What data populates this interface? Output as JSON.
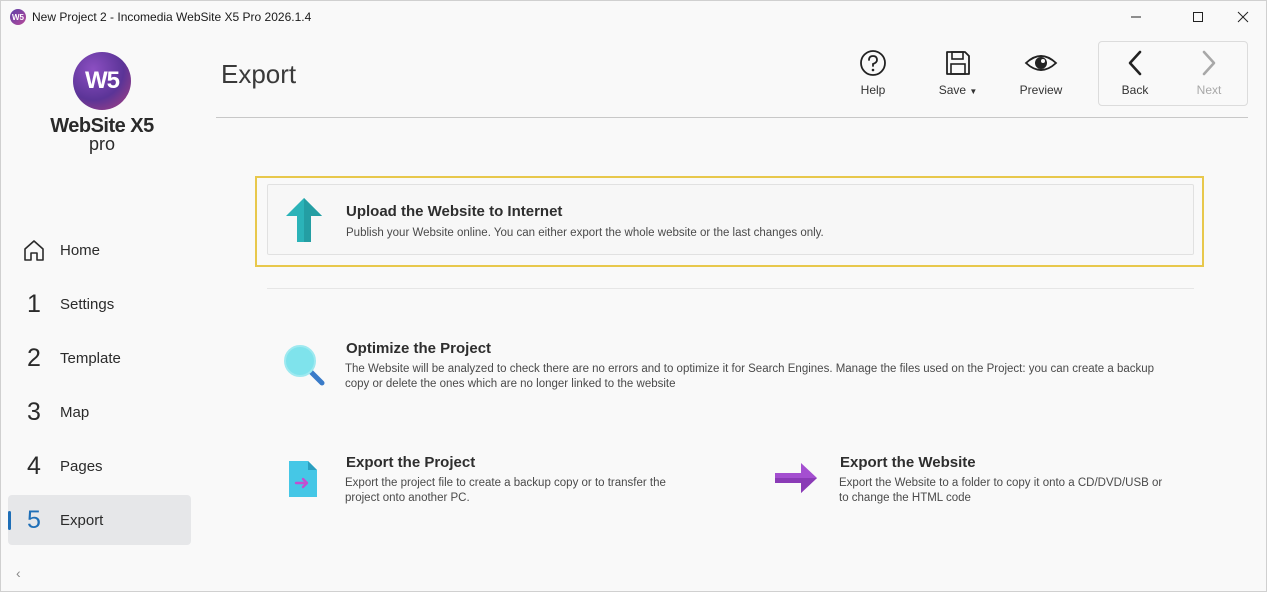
{
  "window": {
    "title": "New Project 2 - Incomedia WebSite X5 Pro 2026.1.4",
    "app_icon_text": "W5"
  },
  "logo": {
    "mark": "W5",
    "name": "WebSite X5",
    "sub": "pro"
  },
  "sidebar": {
    "items": [
      {
        "num": "",
        "icon": "home-icon",
        "label": "Home"
      },
      {
        "num": "1",
        "label": "Settings"
      },
      {
        "num": "2",
        "label": "Template"
      },
      {
        "num": "3",
        "label": "Map"
      },
      {
        "num": "4",
        "label": "Pages"
      },
      {
        "num": "5",
        "label": "Export",
        "active": true
      }
    ],
    "collapse": "‹"
  },
  "header": {
    "title": "Export",
    "toolbar": {
      "help": "Help",
      "save": "Save",
      "preview": "Preview",
      "back": "Back",
      "next": "Next"
    }
  },
  "main": {
    "upload": {
      "title": "Upload the Website to Internet",
      "desc": "Publish your Website online. You can either export the whole website or the last changes only."
    },
    "optimize": {
      "title": "Optimize the Project",
      "desc_line1": "The Website will be analyzed to check there are no errors and to optimize it for Search Engines. Manage the files used on the Project: you can create a backup",
      "desc_line2": "copy or delete the ones which are no longer linked to the website"
    },
    "export_project": {
      "title": "Export the Project",
      "desc_line1": "Export the project file to create a backup copy or to transfer the",
      "desc_line2": "project onto another PC."
    },
    "export_website": {
      "title": "Export the Website",
      "desc_line1": "Export the Website to a folder to copy it onto a CD/DVD/USB or",
      "desc_line2": "to change the HTML code"
    }
  },
  "colors": {
    "accent": "#1f6fb7",
    "highlight": "#e8c84c",
    "upload_arrow": "#2bb3b8",
    "export_arrow": "#a44fd0"
  }
}
